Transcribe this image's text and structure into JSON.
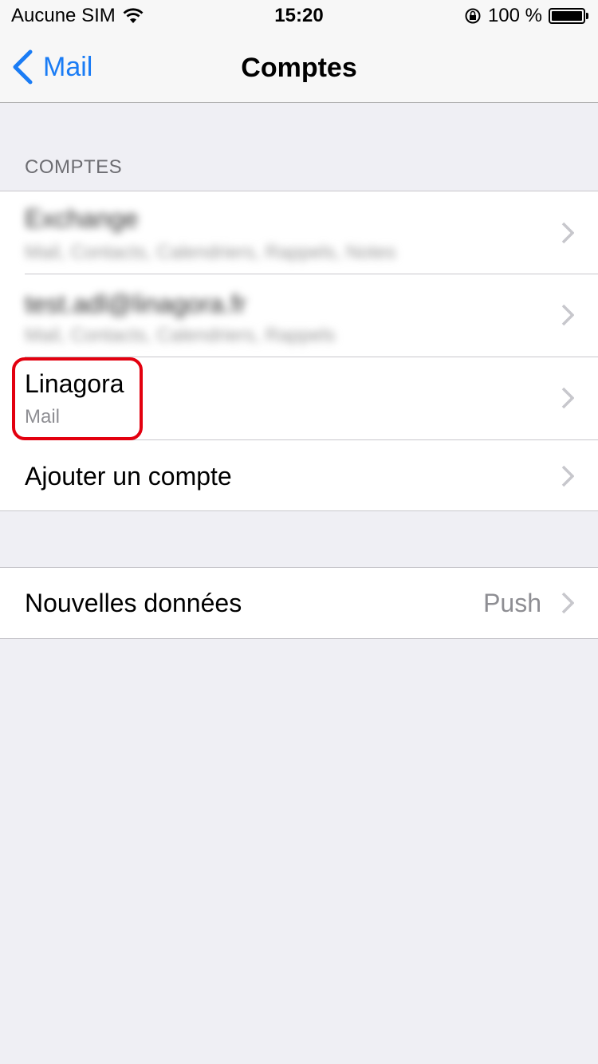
{
  "status_bar": {
    "carrier": "Aucune SIM",
    "time": "15:20",
    "battery_percent": "100 %"
  },
  "nav": {
    "back_label": "Mail",
    "title": "Comptes"
  },
  "section_header": "COMPTES",
  "accounts": [
    {
      "title": "Exchange",
      "subtitle": "Mail, Contacts, Calendriers, Rappels, Notes",
      "blurred": true
    },
    {
      "title": "test.adl@linagora.fr",
      "subtitle": "Mail, Contacts, Calendriers, Rappels",
      "blurred": true
    },
    {
      "title": "Linagora",
      "subtitle": "Mail",
      "blurred": false,
      "highlighted": true
    }
  ],
  "add_account_label": "Ajouter un compte",
  "fetch": {
    "label": "Nouvelles données",
    "value": "Push"
  },
  "colors": {
    "accent": "#1a7cf5",
    "highlight": "#e3000f",
    "background": "#efeff4"
  }
}
